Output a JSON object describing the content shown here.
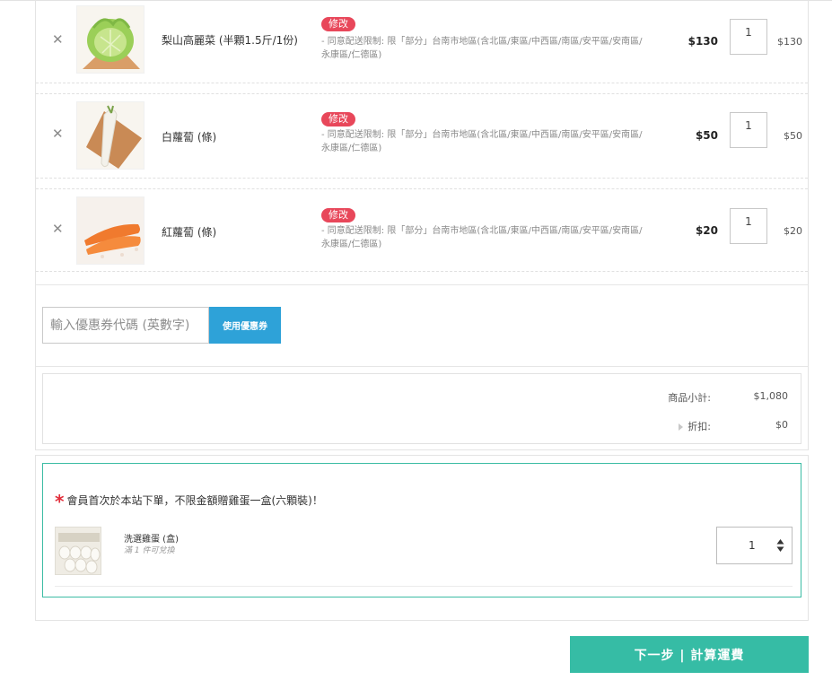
{
  "cart": {
    "items": [
      {
        "name": "梨山高麗菜 (半顆1.5斤/1份)",
        "edit_label": "修改",
        "shipping_note": "- 同意配送限制: 限「部分」台南市地區(含北區/東區/中西區/南區/安平區/安南區/永康區/仁德區)",
        "unit_price": "$130",
        "quantity": "1",
        "line_total": "$130",
        "image_icon": "cabbage-image"
      },
      {
        "name": "白蘿蔔 (條)",
        "edit_label": "修改",
        "shipping_note": "- 同意配送限制: 限「部分」台南市地區(含北區/東區/中西區/南區/安平區/安南區/永康區/仁德區)",
        "unit_price": "$50",
        "quantity": "1",
        "line_total": "$50",
        "image_icon": "white-radish-image"
      },
      {
        "name": "紅蘿蔔 (條)",
        "edit_label": "修改",
        "shipping_note": "- 同意配送限制: 限「部分」台南市地區(含北區/東區/中西區/南區/安平區/安南區/永康區/仁德區)",
        "unit_price": "$20",
        "quantity": "1",
        "line_total": "$20",
        "image_icon": "carrot-image"
      }
    ]
  },
  "coupon": {
    "placeholder": "輸入優惠券代碼 (英數字)",
    "apply_label": "使用優惠券"
  },
  "summary": {
    "subtotal_label": "商品小計:",
    "subtotal_value": "$1,080",
    "discount_label": "折扣:",
    "discount_value": "$0"
  },
  "gift": {
    "title": "會員首次於本站下單，不限金額贈雞蛋一盒(六顆裝)！",
    "item_name": "洗選雞蛋 (盒)",
    "item_condition": "滿 1 件可兌換",
    "quantity": "1"
  },
  "actions": {
    "next_label": "下一步 | 計算運費"
  },
  "colors": {
    "badge": "#e8475a",
    "coupon_button": "#2ea2d8",
    "accent_teal": "#36bca5",
    "asterisk": "#e22d3a"
  }
}
